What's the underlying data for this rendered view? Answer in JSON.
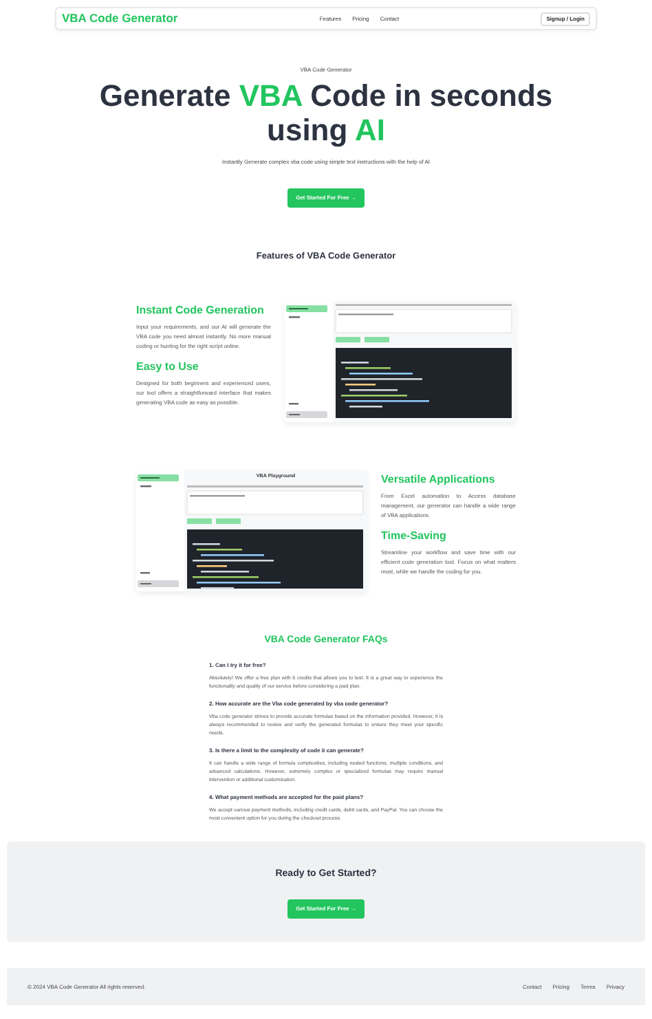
{
  "nav": {
    "brand": "VBA Code Generator",
    "links": [
      "Features",
      "Pricing",
      "Contact"
    ],
    "button": "Signup / Login"
  },
  "hero": {
    "eyebrow": "VBA Code Generator",
    "title": [
      {
        "text": "Generate ",
        "highlight": false
      },
      {
        "text": "VBA",
        "highlight": true
      },
      {
        "text": " Code in seconds using ",
        "highlight": false
      },
      {
        "text": "AI",
        "highlight": true
      }
    ],
    "subtitle": "Instantly Generate complex vba code using simple text instructions with the help of AI",
    "cta": "Get Started For Free →"
  },
  "features": {
    "title": "Features of VBA Code Generator",
    "blocks": [
      {
        "kind": "image-right",
        "items": [
          {
            "title": "Instant Code Generation",
            "text": "Input your requirements, and our AI will generate the VBA code you need almost instantly. No more manual coding or hunting for the right script online."
          },
          {
            "title": "Easy to Use",
            "text": "Designed for both beginners and experienced users, our tool offers a straightforward interface that makes generating VBA code as easy as possible."
          }
        ]
      },
      {
        "kind": "image-left",
        "items": [
          {
            "title": "Versatile Applications",
            "text": "From Excel automation to Access database management, our generator can handle a wide range of VBA applications."
          },
          {
            "title": "Time-Saving",
            "text": "Streamline your workflow and save time with our efficient code generation tool. Focus on what matters most, while we handle the coding for you."
          }
        ],
        "screenshot": {
          "heading": "VBA Playground"
        }
      }
    ]
  },
  "faq": {
    "title": "VBA Code Generator FAQs",
    "items": [
      {
        "question": "1. Can I try it for free?",
        "answer": "Absolutely! We offer a free plan with 5 credits that allows you to test. It is a great way to experience the functionality and quality of our service before considering a paid plan."
      },
      {
        "question": "2. How accurate are the Vba code generated by vba code generator?",
        "answer": "Vba code generator strives to provide accurate formulas based on the information provided. However, it is always recommended to review and verify the generated formulas to ensure they meet your specific needs."
      },
      {
        "question": "3. Is there a limit to the complexity of code it can generate?",
        "answer": "It can handle a wide range of formula complexities, including nested functions, multiple conditions, and advanced calculations. However, extremely complex or specialized formulas may require manual intervention or additional customization."
      },
      {
        "question": "4. What payment methods are accepted for the paid plans?",
        "answer": "We accept various payment methods, including credit cards, debit cards, and PayPal. You can choose the most convenient option for you during the checkout process."
      }
    ]
  },
  "cta": {
    "title": "Ready to Get Started?",
    "button": "Get Started For Free →"
  },
  "footer": {
    "copyright": "© 2024 VBA Code Generator All rights reserved.",
    "links": [
      "Contact",
      "Pricing",
      "Terms",
      "Privacy"
    ]
  }
}
